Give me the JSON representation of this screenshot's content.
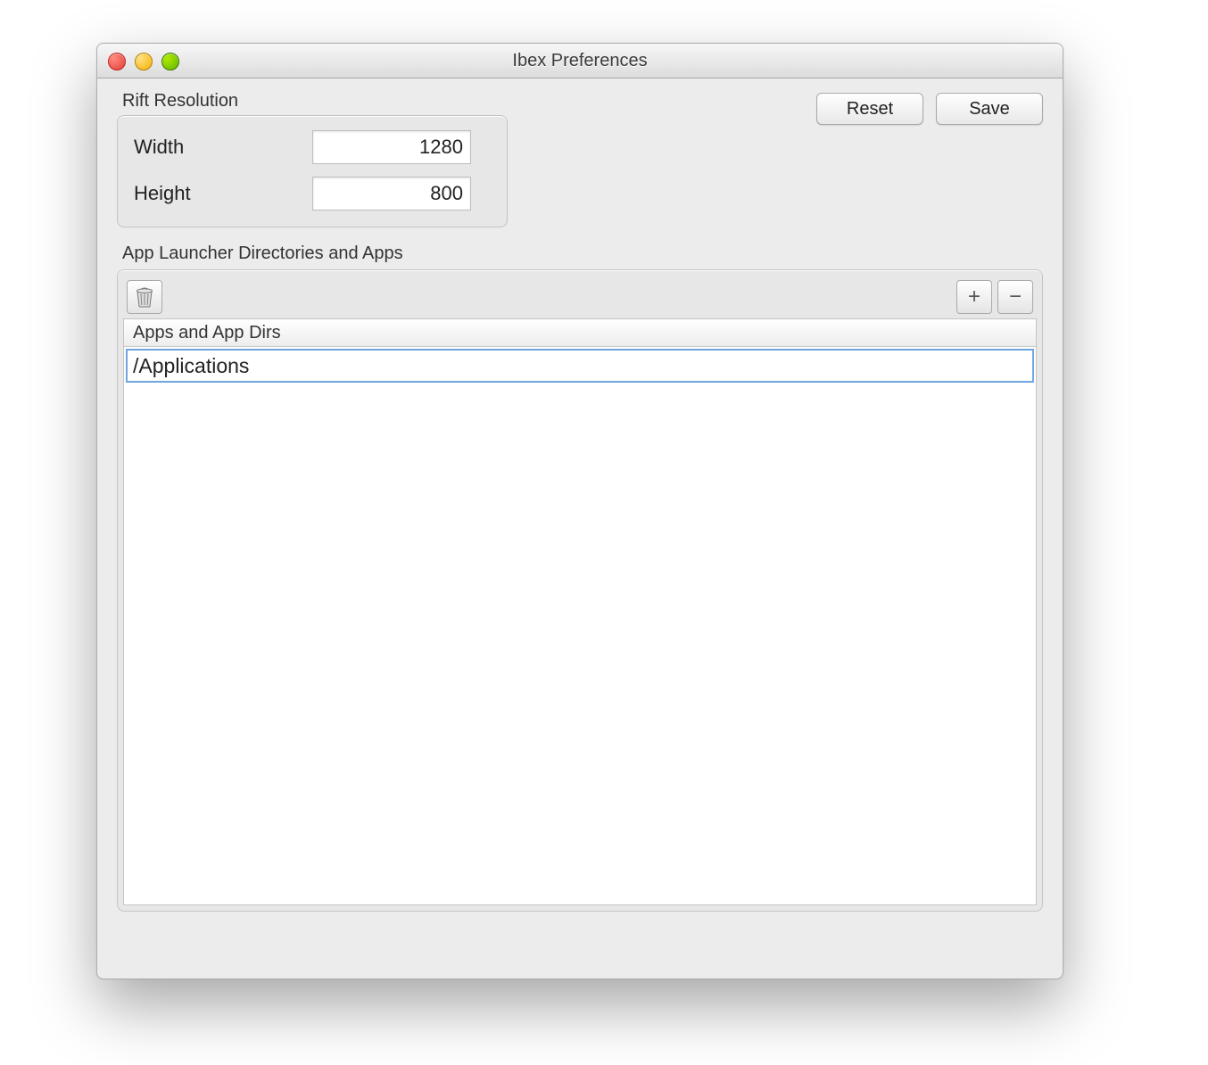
{
  "window": {
    "title": "Ibex Preferences"
  },
  "buttons": {
    "reset": "Reset",
    "save": "Save"
  },
  "rift": {
    "group_label": "Rift Resolution",
    "width_label": "Width",
    "height_label": "Height",
    "width_value": "1280",
    "height_value": "800"
  },
  "launcher": {
    "section_label": "App Launcher Directories and Apps",
    "column_header": "Apps and App Dirs",
    "rows": [
      "/Applications"
    ],
    "toolbar": {
      "trash_icon": "trash-icon",
      "add_icon": "plus-icon",
      "remove_icon": "minus-icon"
    }
  }
}
